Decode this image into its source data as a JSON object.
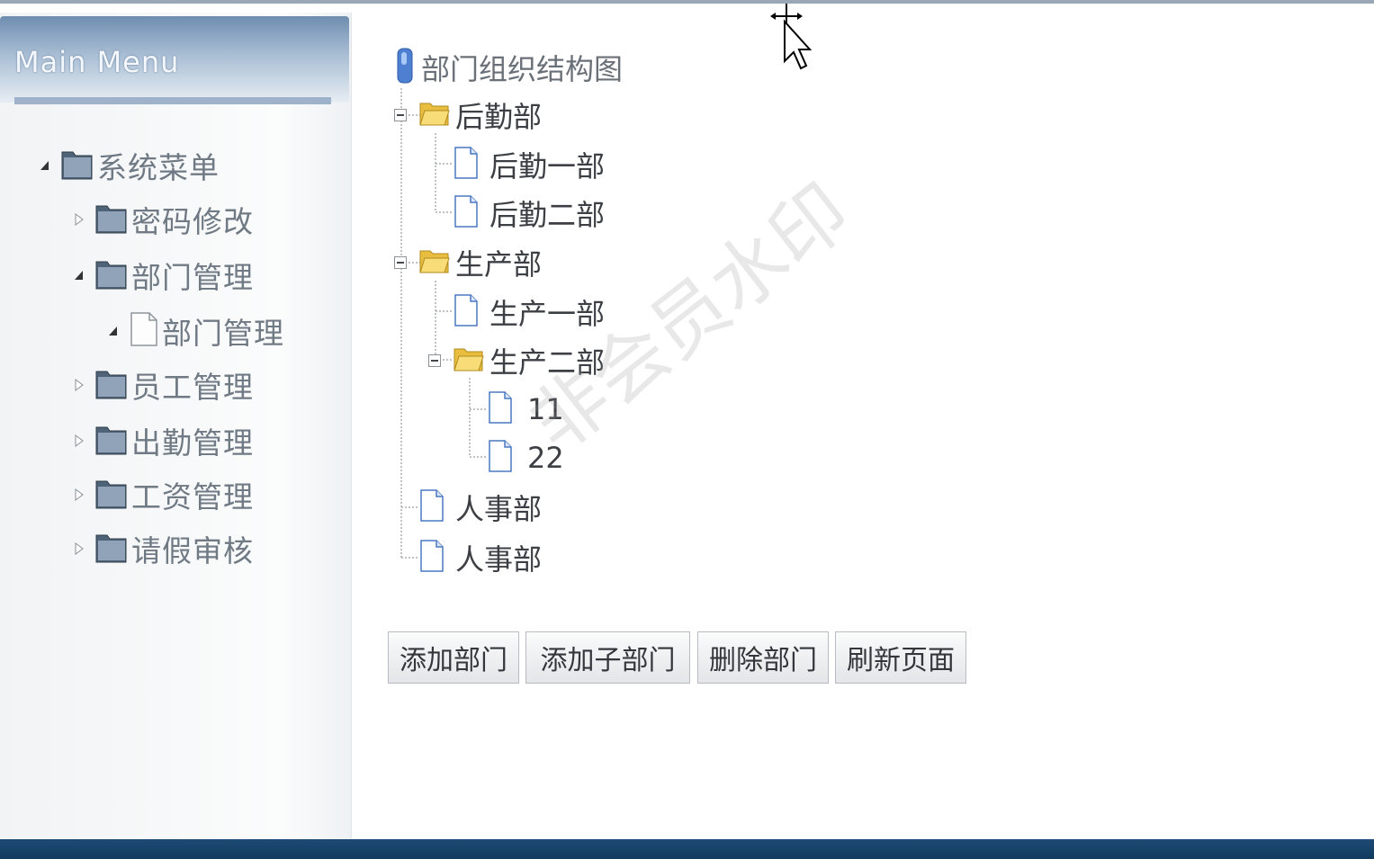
{
  "sidebar": {
    "title": "Main Menu",
    "items": [
      {
        "label": "系统菜单"
      },
      {
        "label": "密码修改"
      },
      {
        "label": "部门管理"
      },
      {
        "label": "部门管理"
      },
      {
        "label": "员工管理"
      },
      {
        "label": "出勤管理"
      },
      {
        "label": "工资管理"
      },
      {
        "label": "请假审核"
      }
    ]
  },
  "main": {
    "tree_title": "部门组织结构图",
    "nodes": [
      {
        "label": "后勤部"
      },
      {
        "label": "后勤一部"
      },
      {
        "label": "后勤二部"
      },
      {
        "label": "生产部"
      },
      {
        "label": "生产一部"
      },
      {
        "label": "生产二部"
      },
      {
        "label": "11"
      },
      {
        "label": "22"
      },
      {
        "label": "人事部"
      },
      {
        "label": "人事部"
      }
    ],
    "buttons": {
      "add_dept": "添加部门",
      "add_sub_dept": "添加子部门",
      "delete_dept": "删除部门",
      "refresh": "刷新页面"
    }
  },
  "watermark": "非会员水印",
  "colors": {
    "bottom_bar": "#1a4670",
    "menu_header": "#7f9bbb",
    "folder_yellow": "#f2cf5b",
    "folder_blue": "#5b6f86"
  }
}
